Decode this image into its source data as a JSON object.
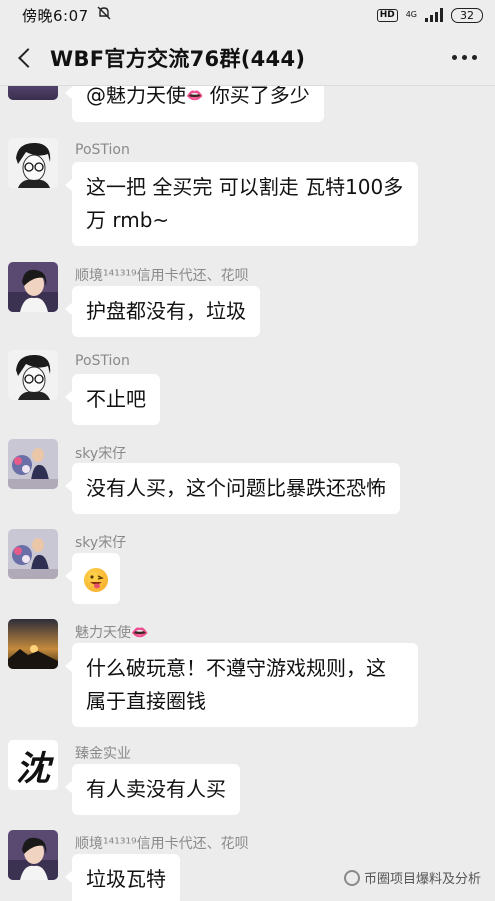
{
  "status_bar": {
    "time": "傍晚6:07",
    "hd": "HD",
    "network": "4G",
    "battery": "32"
  },
  "header": {
    "title": "WBF官方交流76群(444)"
  },
  "messages": [
    {
      "sender": "",
      "text": "@魅力天使",
      "suffix": " 你买了多少"
    },
    {
      "sender": "PoSTion",
      "text": "这一把 全买完 可以割走 瓦特100多万 rmb~"
    },
    {
      "sender": "顺境¹⁴¹³¹⁹信用卡代还、花呗",
      "text": "护盘都没有，垃圾"
    },
    {
      "sender": "PoSTion",
      "text": "不止吧"
    },
    {
      "sender": "sky宋仔",
      "text": "没有人买，这个问题比暴跌还恐怖"
    },
    {
      "sender": "sky宋仔",
      "text": ""
    },
    {
      "sender": "魅力天使",
      "text": "什么破玩意！不遵守游戏规则，这属于直接圈钱"
    },
    {
      "sender": "臻金实业",
      "text": "有人卖没有人买"
    },
    {
      "sender": "顺境¹⁴¹³¹⁹信用卡代还、花呗",
      "text": "垃圾瓦特"
    }
  ],
  "avatar_glyph": "沈",
  "watermark": "币圈项目爆料及分析",
  "colors": {
    "background": "#ececec",
    "bubble": "#ffffff",
    "sender": "#8a8a8a"
  }
}
